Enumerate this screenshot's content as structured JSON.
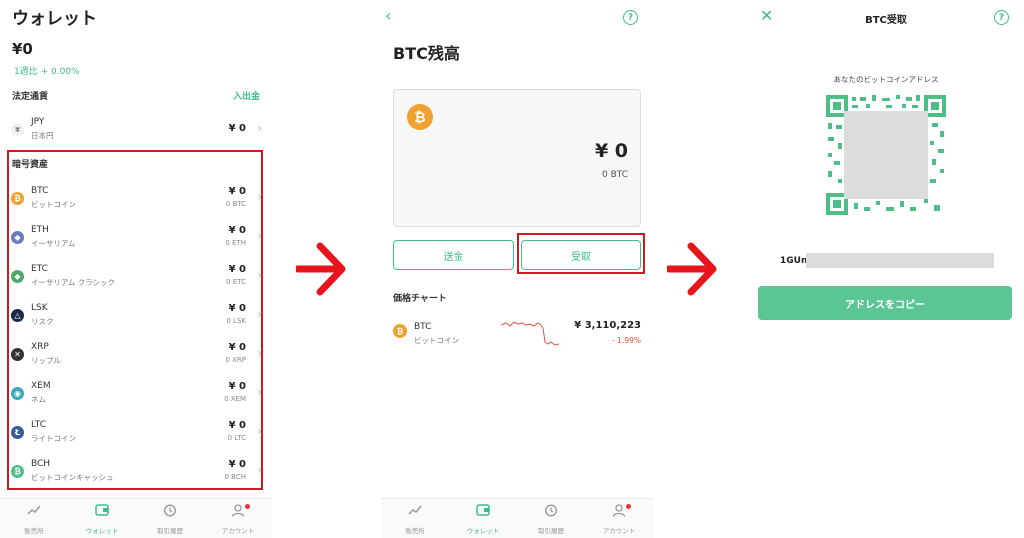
{
  "wallet": {
    "title": "ウォレット",
    "balance": "¥0",
    "weekly_change": "1週比 + 0.00%",
    "fiat_section": "法定通貨",
    "deposit_link": "入出金",
    "fiat": {
      "symbol": "JPY",
      "name": "日本円",
      "value": "¥ 0",
      "icon": "yen-icon"
    },
    "crypto_section": "暗号資産",
    "crypto": [
      {
        "symbol": "BTC",
        "name": "ビットコイン",
        "value": "¥ 0",
        "sub": "0 BTC",
        "icon_color": "#f0a12f",
        "glyph": "₿"
      },
      {
        "symbol": "ETH",
        "name": "イーサリアム",
        "value": "¥ 0",
        "sub": "0 ETH",
        "icon_color": "#6b7bbf",
        "glyph": "◆"
      },
      {
        "symbol": "ETC",
        "name": "イーサリアム クラシック",
        "value": "¥ 0",
        "sub": "0 ETC",
        "icon_color": "#4fa86a",
        "glyph": "◆"
      },
      {
        "symbol": "LSK",
        "name": "リスク",
        "value": "¥ 0",
        "sub": "0 LSK",
        "icon_color": "#1a2a4a",
        "glyph": "△"
      },
      {
        "symbol": "XRP",
        "name": "リップル",
        "value": "¥ 0",
        "sub": "0 XRP",
        "icon_color": "#333333",
        "glyph": "✕"
      },
      {
        "symbol": "XEM",
        "name": "ネム",
        "value": "¥ 0",
        "sub": "0 XEM",
        "icon_color": "#3aa6b8",
        "glyph": "◉"
      },
      {
        "symbol": "LTC",
        "name": "ライトコイン",
        "value": "¥ 0",
        "sub": "0 LTC",
        "icon_color": "#345d9d",
        "glyph": "Ł"
      },
      {
        "symbol": "BCH",
        "name": "ビットコインキャッシュ",
        "value": "¥ 0",
        "sub": "0 BCH",
        "icon_color": "#4cc28a",
        "glyph": "₿"
      }
    ]
  },
  "tabs": [
    {
      "label": "販売所",
      "icon": "trend-icon"
    },
    {
      "label": "ウォレット",
      "icon": "wallet-icon"
    },
    {
      "label": "取引履歴",
      "icon": "history-icon"
    },
    {
      "label": "アカウント",
      "icon": "account-icon"
    }
  ],
  "btc_detail": {
    "title": "BTC残高",
    "value": "¥ 0",
    "sub": "0 BTC",
    "send_label": "送金",
    "receive_label": "受取",
    "chart_section": "価格チャート",
    "price_symbol": "BTC",
    "price_name": "ビットコイン",
    "price": "¥ 3,110,223",
    "price_change": "- 1.99%"
  },
  "receive": {
    "title": "BTC受取",
    "caption": "あなたのビットコインアドレス",
    "address_prefix": "1GUn",
    "copy_label": "アドレスをコピー"
  },
  "colors": {
    "accent": "#3fbd85",
    "highlight": "#d3181f",
    "negative": "#e0523f"
  }
}
